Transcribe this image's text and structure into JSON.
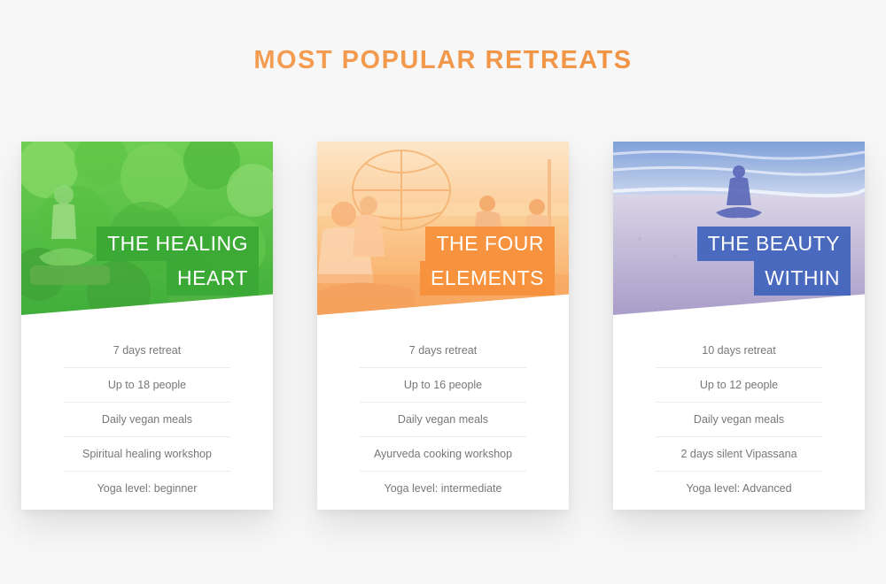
{
  "section": {
    "title": "MOST POPULAR RETREATS"
  },
  "colors": {
    "title_orange": "#ef8d3a",
    "card_green": "#3aa834",
    "card_orange": "#f68f39",
    "card_blue": "#3f63bc",
    "text_gray": "#777777"
  },
  "cards": [
    {
      "heading_line1": "THE HEALING",
      "heading_line2": "HEART",
      "image": "woman meditating among green trees",
      "details": [
        "7 days retreat",
        "Up to 18 people",
        "Daily vegan meals",
        "Spiritual healing workshop",
        "Yoga level: beginner"
      ]
    },
    {
      "heading_line1": "THE FOUR",
      "heading_line2": "ELEMENTS",
      "image": "group meditating outdoors at sunset",
      "details": [
        "7 days retreat",
        "Up to 16 people",
        "Daily vegan meals",
        "Ayurveda cooking workshop",
        "Yoga level: intermediate"
      ]
    },
    {
      "heading_line1": "THE BEAUTY",
      "heading_line2": "WITHIN",
      "image": "person meditating on beach",
      "details": [
        "10 days retreat",
        "Up to 12 people",
        "Daily vegan meals",
        "2 days silent Vipassana",
        "Yoga level: Advanced"
      ]
    }
  ]
}
